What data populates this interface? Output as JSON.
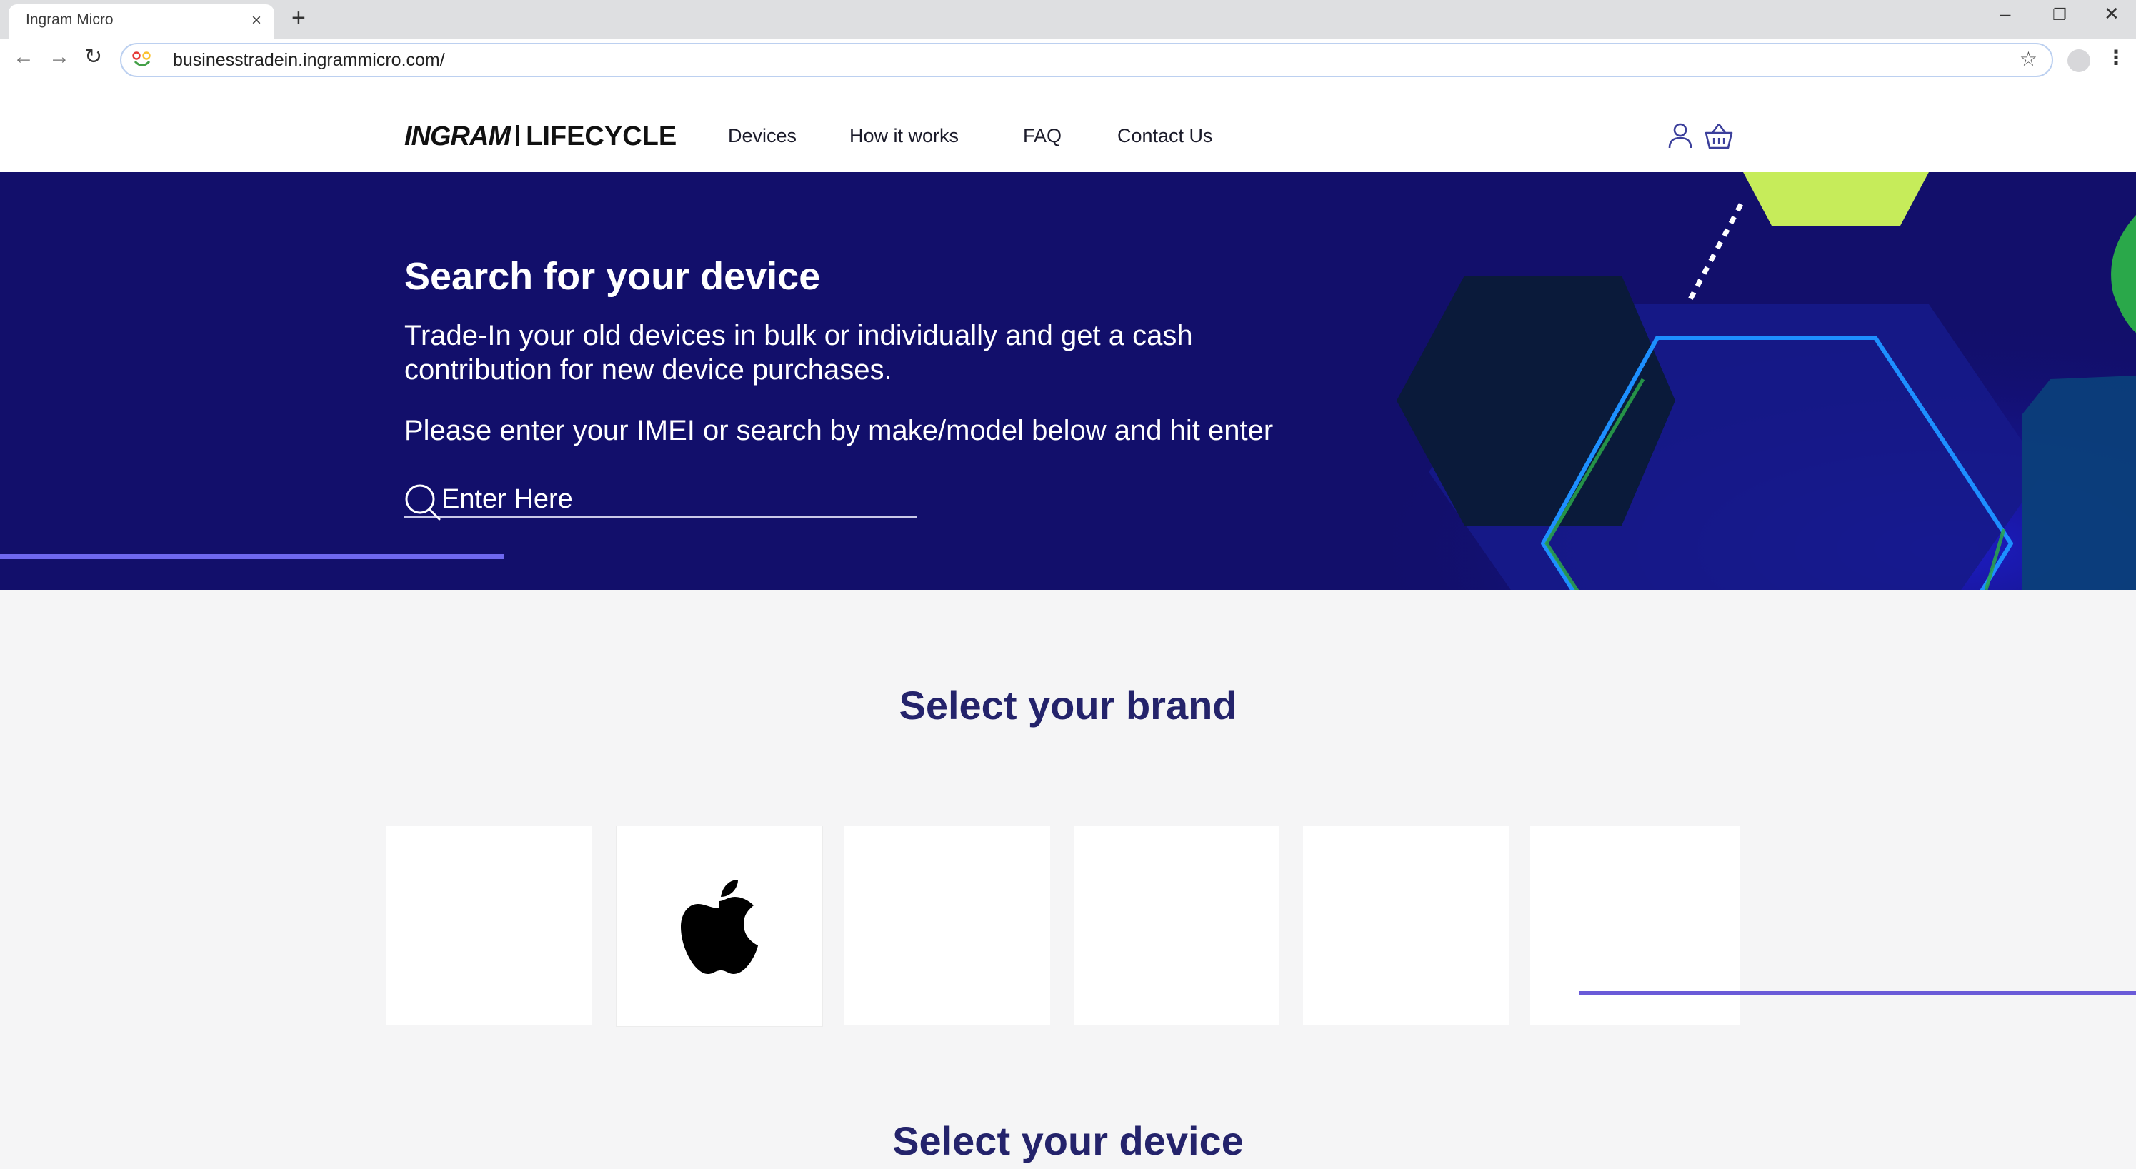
{
  "browser": {
    "tab_title": "Ingram Micro",
    "tab_close": "×",
    "new_tab": "+",
    "url": "businesstradein.ingrammicro.com/",
    "controls": {
      "minimize": "–",
      "restore": "❐",
      "close": "✕"
    },
    "nav": {
      "back": "←",
      "forward": "→",
      "reload": "↻"
    },
    "star": "☆",
    "menu": "⋮"
  },
  "header": {
    "logo_brand": "INGRAM",
    "logo_product": "LIFECYCLE",
    "nav": [
      "Devices",
      "How it works",
      "FAQ",
      "Contact Us"
    ]
  },
  "hero": {
    "title": "Search for your device",
    "description": "Trade-In your old devices in bulk or individually and get a cash contribution for new device purchases.",
    "instruction": "Please enter your IMEI or search by make/model below and hit enter",
    "search_placeholder": "Enter Here",
    "progress": 0.236
  },
  "brands": {
    "title": "Select your brand",
    "cards": [
      "",
      "apple-icon",
      "",
      "",
      "",
      ""
    ],
    "carousel_progress": 0.26
  },
  "devices": {
    "title": "Select your device"
  },
  "colors": {
    "hero_bg": "#120f6b",
    "heading": "#24236b",
    "accent_lime": "#c6ec5a",
    "accent_blue": "#1d8fff",
    "progress": "#6f68f0"
  }
}
